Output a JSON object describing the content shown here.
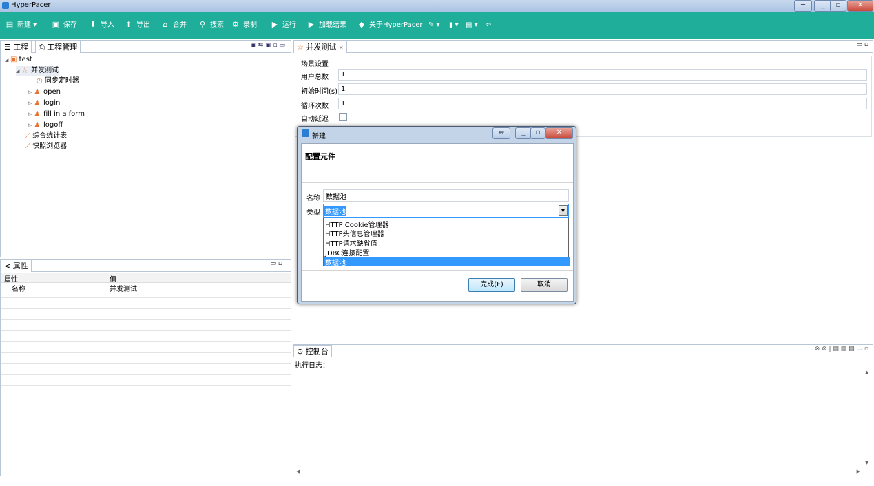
{
  "window": {
    "title": "HyperPacer"
  },
  "toolbar": {
    "items": [
      "新建",
      "保存",
      "导入",
      "导出",
      "合并",
      "搜索",
      "录制",
      "运行",
      "加载结果",
      "关于HyperPacer"
    ]
  },
  "project_panel": {
    "tabs": [
      "工程",
      "工程管理"
    ],
    "tree": {
      "root": "test",
      "scenario": "并发测试",
      "timer": "同步定时器",
      "steps": [
        "open",
        "login",
        "fill in a form",
        "logoff"
      ],
      "reports": [
        "综合统计表",
        "快照浏览器"
      ]
    }
  },
  "properties_panel": {
    "tab": "属性",
    "columns": [
      "属性",
      "值"
    ],
    "rows": [
      {
        "key": "名称",
        "value": "并发测试"
      }
    ]
  },
  "editor": {
    "tab": "并发测试",
    "section": "场景设置",
    "fields": [
      {
        "label": "用户总数",
        "value": "1"
      },
      {
        "label": "初始时间(s)",
        "value": "1"
      },
      {
        "label": "循环次数",
        "value": "1"
      }
    ],
    "checkbox_label": "自动延迟"
  },
  "console": {
    "tab": "控制台",
    "log_label": "执行日志："
  },
  "dialog": {
    "title": "新建",
    "heading": "配置元件",
    "name_label": "名称",
    "name_value": "数据池",
    "type_label": "类型",
    "type_value": "数据池",
    "options": [
      "HTTP Cookie管理器",
      "HTTP头信息管理器",
      "HTTP请求缺省值",
      "JDBC连接配置",
      "数据池"
    ],
    "selected_option": "数据池",
    "finish_label": "完成(F)",
    "cancel_label": "取消"
  },
  "colors": {
    "toolbar": "#1fae99",
    "selection": "#3399ff",
    "accent": "#e8702c"
  }
}
